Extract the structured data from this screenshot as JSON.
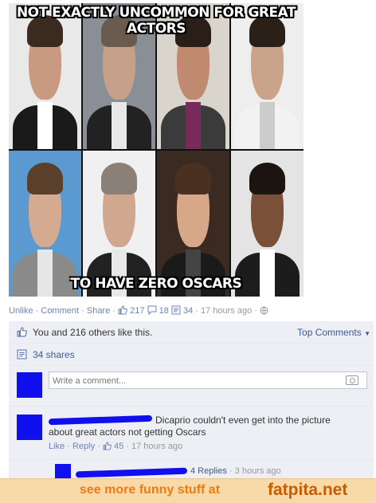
{
  "meme": {
    "top_text": "NOT EXACTLY UNCOMMON FOR GREAT ACTORS",
    "bottom_text": "TO HAVE ZERO OSCARS"
  },
  "actions": {
    "unlike": "Unlike",
    "comment": "Comment",
    "share": "Share",
    "likes": "217",
    "comments": "18",
    "shares": "34",
    "time": "17 hours ago"
  },
  "feedback": {
    "likes_text": "You and 216 others like this.",
    "sort_label": "Top Comments",
    "shares_text": "34 shares",
    "comment_placeholder": "Write a comment..."
  },
  "comment": {
    "text": "Dicaprio couldn't even get into the picture about great actors not getting Oscars",
    "like": "Like",
    "reply": "Reply",
    "likes": "45",
    "time": "17 hours ago"
  },
  "replies": {
    "count_text": "4 Replies",
    "time": "3 hours ago"
  },
  "banner": {
    "text": "see more funny stuff at",
    "site": "fatpita.net"
  }
}
